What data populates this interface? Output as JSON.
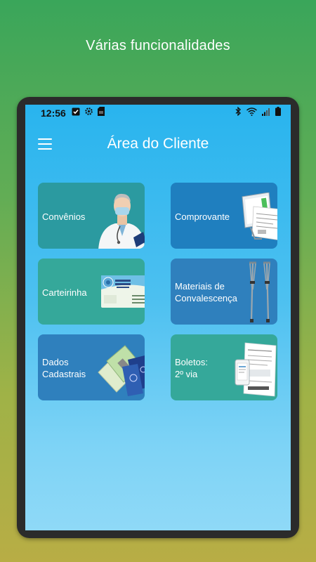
{
  "promo": {
    "title": "Várias funcionalidades"
  },
  "status_bar": {
    "time": "12:56",
    "left_icons": [
      "check-box-icon",
      "settings-gear-icon",
      "sd-card-icon"
    ],
    "right_icons": [
      "bluetooth-icon",
      "wifi-icon",
      "signal-icon",
      "battery-icon"
    ]
  },
  "app_bar": {
    "title": "Área do Cliente",
    "menu_icon": "hamburger-menu-icon"
  },
  "cards": [
    {
      "label": "Convênios",
      "icon": "doctor-image"
    },
    {
      "label": "Comprovante",
      "icon": "computer-receipt-image"
    },
    {
      "label": "Carteirinha",
      "icon": "membership-card-image"
    },
    {
      "label": "Materiais de\nConvalescença",
      "icon": "crutches-image"
    },
    {
      "label": "Dados\nCadastrais",
      "icon": "documents-image"
    },
    {
      "label": "Boletos:\n2º via",
      "icon": "invoice-image"
    }
  ],
  "colors": {
    "background_top": "#3aa65a",
    "background_bottom": "#b8ad45",
    "screen_top": "#29b4ee",
    "card_teal": "#2b9aa0",
    "card_blue": "#1f7fbf",
    "card_green": "#35a89a"
  }
}
